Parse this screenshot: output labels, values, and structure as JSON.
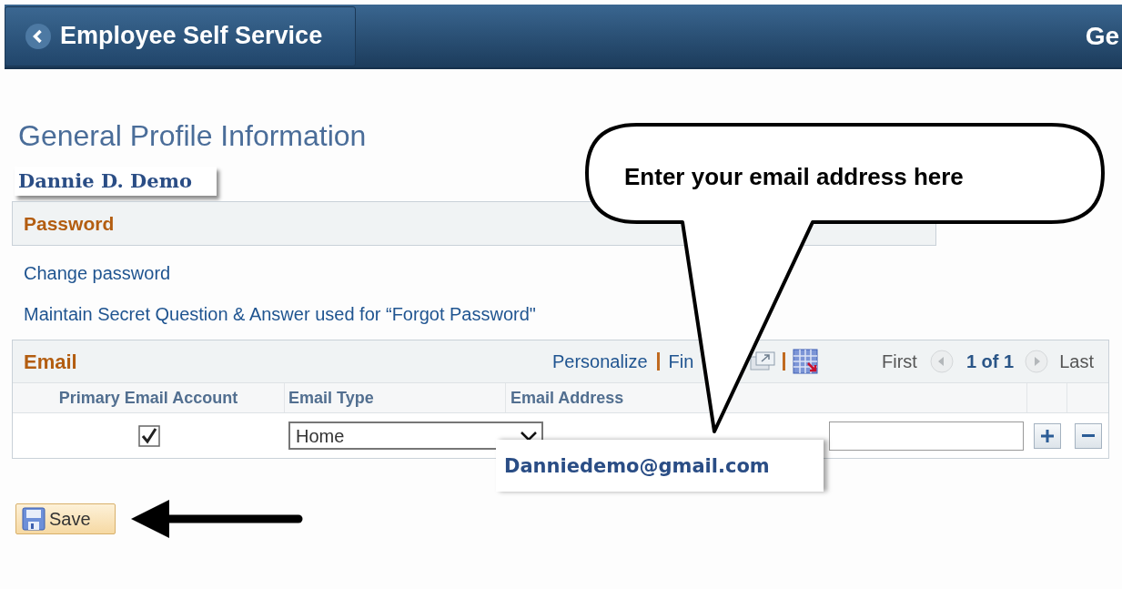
{
  "header": {
    "back_button": "Employee Self Service",
    "page_title": "Ge"
  },
  "page_heading": "General Profile Information",
  "person_name": "Dannie D. Demo",
  "password_section": {
    "title": "Password",
    "links": [
      "Change password",
      "Maintain Secret Question & Answer used for “Forgot Password\""
    ]
  },
  "email_grid": {
    "title": "Email",
    "toolbar": {
      "personalize": "Personalize",
      "find": "Fin",
      "first": "First",
      "count": "1 of 1",
      "last": "Last"
    },
    "columns": [
      "Primary Email Account",
      "Email Type",
      "Email Address"
    ],
    "rows": [
      {
        "primary": true,
        "email_type": "Home"
      }
    ]
  },
  "save_button": "Save",
  "callout": {
    "text": "Enter your email address here"
  },
  "email_zoom": {
    "text": "Danniedemo@gmail.com"
  }
}
